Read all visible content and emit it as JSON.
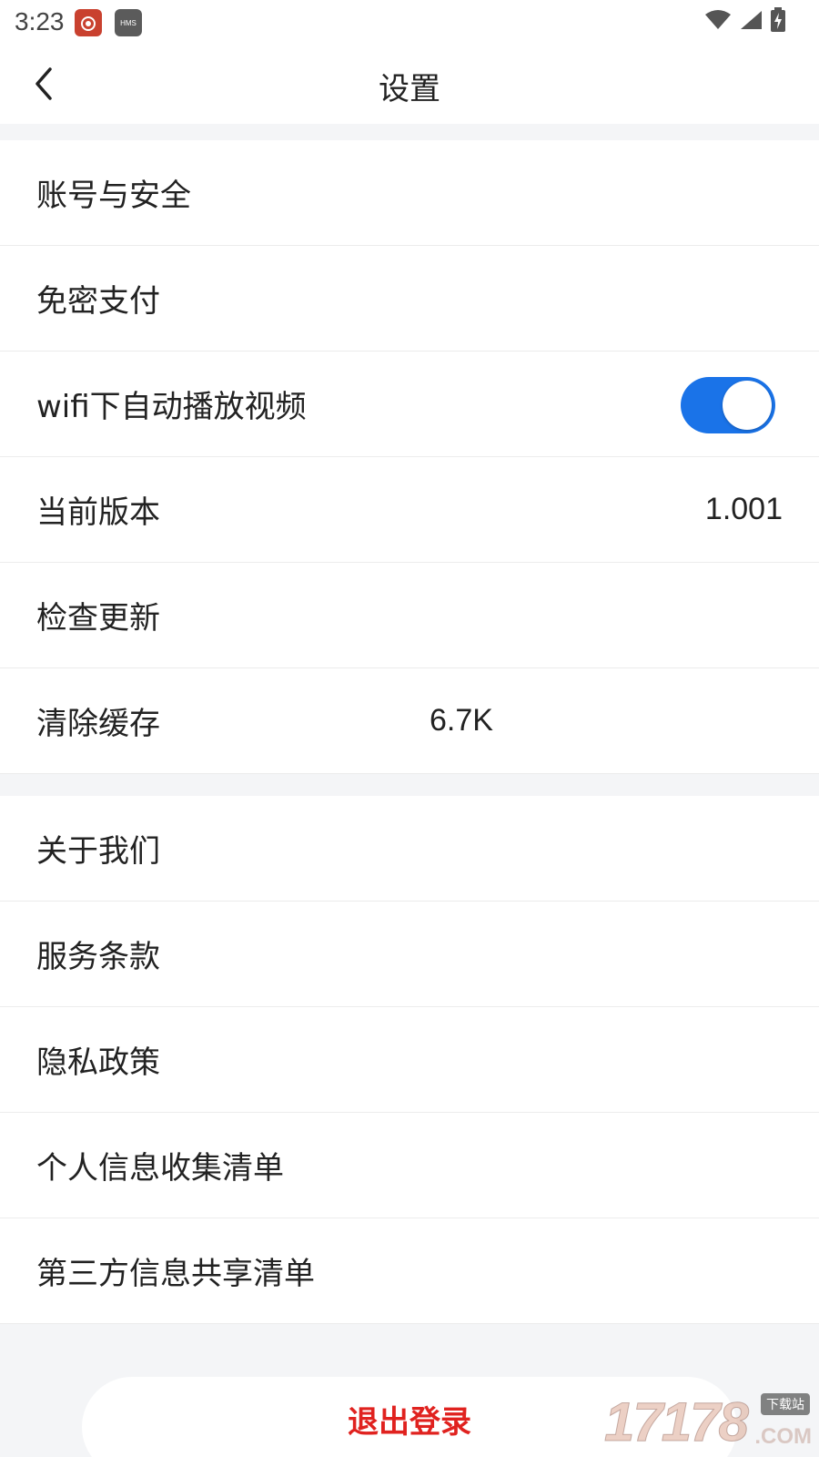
{
  "status_bar": {
    "time": "3:23",
    "app_icons": [
      "weibo-app-icon",
      "hms-app-icon"
    ],
    "hms_label": "HMS"
  },
  "header": {
    "title": "设置",
    "back_icon": "chevron-left-icon"
  },
  "settings_group_1": [
    {
      "label": "账号与安全"
    },
    {
      "label": "免密支付"
    },
    {
      "label": "wifi下自动播放视频",
      "toggle": true
    },
    {
      "label": "当前版本",
      "value": "1.001"
    },
    {
      "label": "检查更新"
    },
    {
      "label": "清除缓存",
      "value": "6.7K"
    }
  ],
  "settings_group_2": [
    {
      "label": "关于我们"
    },
    {
      "label": "服务条款"
    },
    {
      "label": "隐私政策"
    },
    {
      "label": "个人信息收集清单"
    },
    {
      "label": "第三方信息共享清单"
    }
  ],
  "logout_label": "退出登录",
  "watermark": {
    "number": "17178",
    "badge": "下载站",
    "suffix": ".COM"
  },
  "colors": {
    "accent": "#1a73e8",
    "logout_text": "#e0221f",
    "page_background": "#f4f5f7"
  }
}
